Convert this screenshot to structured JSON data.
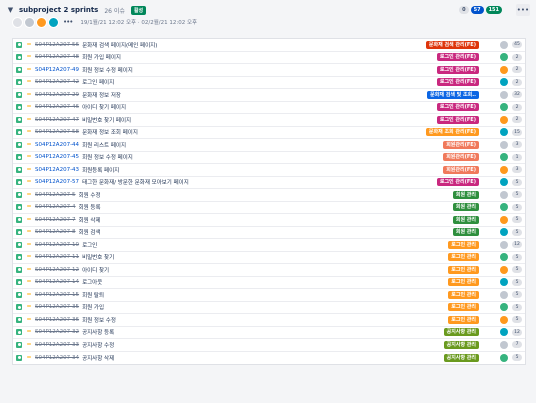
{
  "sprint": {
    "name": "subproject 2 sprints",
    "issue_count": "26 이슈",
    "status": "활성",
    "dates": "19/1월/21 12:02 오후  ·  02/2월/21 12:02 오후",
    "count_todo": "0",
    "count_inprogress": "57",
    "count_done": "151",
    "more_icon": "ellipsis-icon"
  },
  "colors": {
    "orange": "#ff991f",
    "magenta": "#c9287f",
    "red": "#de350b",
    "blue": "#0c66e4",
    "green": "#2f8f3e",
    "olive": "#6a9a1f",
    "salmon": "#f0795b",
    "dark_green": "#006644"
  },
  "issues": [
    {
      "key": "S04P12A207-56",
      "summary": "문화재 검색 페이지(메인 페이지)",
      "epic": "문화재 검색 관리(FE)",
      "epic_color": "#de350b",
      "done": true,
      "estimate": "45"
    },
    {
      "key": "S04P12A207-48",
      "summary": "회원 가입 페이지",
      "epic": "로그인 관리(FE)",
      "epic_color": "#c9287f",
      "done": true,
      "estimate": "2"
    },
    {
      "key": "S04P12A207-49",
      "summary": "회원 정보 수정 페이지",
      "epic": "로그인 관리(FE)",
      "epic_color": "#c9287f",
      "done": false,
      "estimate": "2"
    },
    {
      "key": "S04P12A207-42",
      "summary": "로그인 페이지",
      "epic": "로그인 관리(FE)",
      "epic_color": "#c9287f",
      "done": true,
      "estimate": "2"
    },
    {
      "key": "S04P12A207-29",
      "summary": "문화재 정보 저장",
      "epic": "문화재 검색 및 조회..",
      "epic_color": "#0c66e4",
      "done": true,
      "estimate": "32"
    },
    {
      "key": "S04P12A207-46",
      "summary": "아이디 찾기 페이지",
      "epic": "로그인 관리(FE)",
      "epic_color": "#c9287f",
      "done": true,
      "estimate": "2"
    },
    {
      "key": "S04P12A207-47",
      "summary": "비밀번호 찾기 페이지",
      "epic": "로그인 관리(FE)",
      "epic_color": "#c9287f",
      "done": true,
      "estimate": "2"
    },
    {
      "key": "S04P12A207-58",
      "summary": "문화재 정보 조회 페이지",
      "epic": "문화재 조회 관리(FE)",
      "epic_color": "#ff991f",
      "done": true,
      "estimate": "15"
    },
    {
      "key": "S04P12A207-44",
      "summary": "회원 리스트 페이지",
      "epic": "회원관리(FE)",
      "epic_color": "#f0795b",
      "done": false,
      "estimate": "3"
    },
    {
      "key": "S04P12A207-45",
      "summary": "회원 정보 수정 페이지",
      "epic": "회원관리(FE)",
      "epic_color": "#f0795b",
      "done": false,
      "estimate": "1"
    },
    {
      "key": "S04P12A207-43",
      "summary": "회원등록 페이지",
      "epic": "회원관리(FE)",
      "epic_color": "#f0795b",
      "done": false,
      "estimate": "3"
    },
    {
      "key": "S04P12A207-57",
      "summary": "태그한 문화재/ 방문한 문화재 모아보기 페이지",
      "epic": "로그인 관리(FE)",
      "epic_color": "#c9287f",
      "done": false,
      "estimate": "5"
    },
    {
      "key": "S04P12A207-5",
      "summary": "회원 수정",
      "epic": "회원 관리",
      "epic_color": "#2f8f3e",
      "done": true,
      "estimate": "5"
    },
    {
      "key": "S04P12A207-4",
      "summary": "회원 등록",
      "epic": "회원 관리",
      "epic_color": "#2f8f3e",
      "done": true,
      "estimate": "5"
    },
    {
      "key": "S04P12A207-7",
      "summary": "회원 삭제",
      "epic": "회원 관리",
      "epic_color": "#2f8f3e",
      "done": true,
      "estimate": "5"
    },
    {
      "key": "S04P12A207-8",
      "summary": "회원 검색",
      "epic": "회원 관리",
      "epic_color": "#2f8f3e",
      "done": true,
      "estimate": "5"
    },
    {
      "key": "S04P12A207-10",
      "summary": "로그인",
      "epic": "로그인 관리",
      "epic_color": "#ff991f",
      "done": true,
      "estimate": "12"
    },
    {
      "key": "S04P12A207-11",
      "summary": "비밀번호 찾기",
      "epic": "로그인 관리",
      "epic_color": "#ff991f",
      "done": true,
      "estimate": "5"
    },
    {
      "key": "S04P12A207-12",
      "summary": "아이디 찾기",
      "epic": "로그인 관리",
      "epic_color": "#ff991f",
      "done": true,
      "estimate": "5"
    },
    {
      "key": "S04P12A207-14",
      "summary": "로그아웃",
      "epic": "로그인 관리",
      "epic_color": "#ff991f",
      "done": true,
      "estimate": "5"
    },
    {
      "key": "S04P12A207-15",
      "summary": "회원 탈퇴",
      "epic": "로그인 관리",
      "epic_color": "#ff991f",
      "done": true,
      "estimate": "5"
    },
    {
      "key": "S04P12A207-35",
      "summary": "회원 가입",
      "epic": "로그인 관리",
      "epic_color": "#ff991f",
      "done": true,
      "estimate": "5"
    },
    {
      "key": "S04P12A207-36",
      "summary": "회원 정보 수정",
      "epic": "로그인 관리",
      "epic_color": "#ff991f",
      "done": true,
      "estimate": "5"
    },
    {
      "key": "S04P12A207-32",
      "summary": "공지사항 등록",
      "epic": "공지사항 관리",
      "epic_color": "#6a9a1f",
      "done": true,
      "estimate": "12"
    },
    {
      "key": "S04P12A207-33",
      "summary": "공지사항 수정",
      "epic": "공지사항 관리",
      "epic_color": "#6a9a1f",
      "done": true,
      "estimate": "7"
    },
    {
      "key": "S04P12A207-34",
      "summary": "공지사항 삭제",
      "epic": "공지사항 관리",
      "epic_color": "#6a9a1f",
      "done": true,
      "estimate": "5"
    }
  ]
}
